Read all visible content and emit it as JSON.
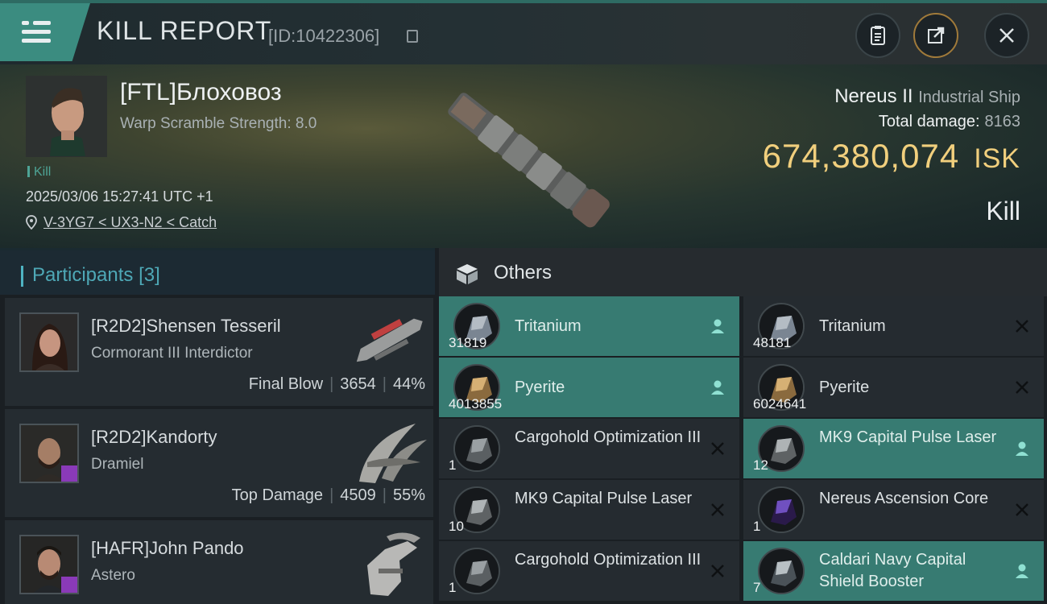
{
  "header": {
    "title": "KILL REPORT",
    "id_text": "[ID:10422306]"
  },
  "victim": {
    "name": "[FTL]Блоховоз",
    "warp_scramble": "Warp Scramble Strength: 8.0",
    "kill_tag": "Kill",
    "datetime": "2025/03/06 15:27:41 UTC +1",
    "location": "V-3YG7 < UX3-N2 < Catch"
  },
  "ship": {
    "name": "Nereus II",
    "class": "Industrial Ship",
    "total_damage_label": "Total damage:",
    "total_damage": "8163",
    "isk_value": "674,380,074",
    "isk_unit": "ISK",
    "result": "Kill"
  },
  "participants": {
    "label": "Participants",
    "count": "[3]",
    "items": [
      {
        "name": "[R2D2]Shensen Tesseril",
        "ship": "Cormorant III Interdictor",
        "role": "Final Blow",
        "damage": "3654",
        "pct": "44%"
      },
      {
        "name": "[R2D2]Kandorty",
        "ship": "Dramiel",
        "role": "Top Damage",
        "damage": "4509",
        "pct": "55%"
      },
      {
        "name": "[HAFR]John Pando",
        "ship": "Astero",
        "role": "",
        "damage": "",
        "pct": ""
      }
    ]
  },
  "others": {
    "label": "Others",
    "items": [
      {
        "name": "Tritanium",
        "qty": "31819",
        "highlight": true,
        "action": "pilot"
      },
      {
        "name": "Tritanium",
        "qty": "48181",
        "highlight": false,
        "action": "close"
      },
      {
        "name": "Pyerite",
        "qty": "4013855",
        "highlight": true,
        "action": "pilot"
      },
      {
        "name": "Pyerite",
        "qty": "6024641",
        "highlight": false,
        "action": "close"
      },
      {
        "name": "Cargohold Optimization III",
        "qty": "1",
        "highlight": false,
        "action": "close"
      },
      {
        "name": "MK9 Capital Pulse Laser",
        "qty": "12",
        "highlight": true,
        "action": "pilot"
      },
      {
        "name": "MK9 Capital Pulse Laser",
        "qty": "10",
        "highlight": false,
        "action": "close"
      },
      {
        "name": "Nereus Ascension Core",
        "qty": "1",
        "highlight": false,
        "action": "close"
      },
      {
        "name": "Cargohold Optimization III",
        "qty": "1",
        "highlight": false,
        "action": "close"
      },
      {
        "name": "Caldari Navy Capital Shield Booster",
        "qty": "7",
        "highlight": true,
        "action": "pilot"
      }
    ]
  },
  "colors": {
    "accent": "#377b72",
    "isk": "#f1cf7d",
    "participants": "#4ea8b6"
  }
}
